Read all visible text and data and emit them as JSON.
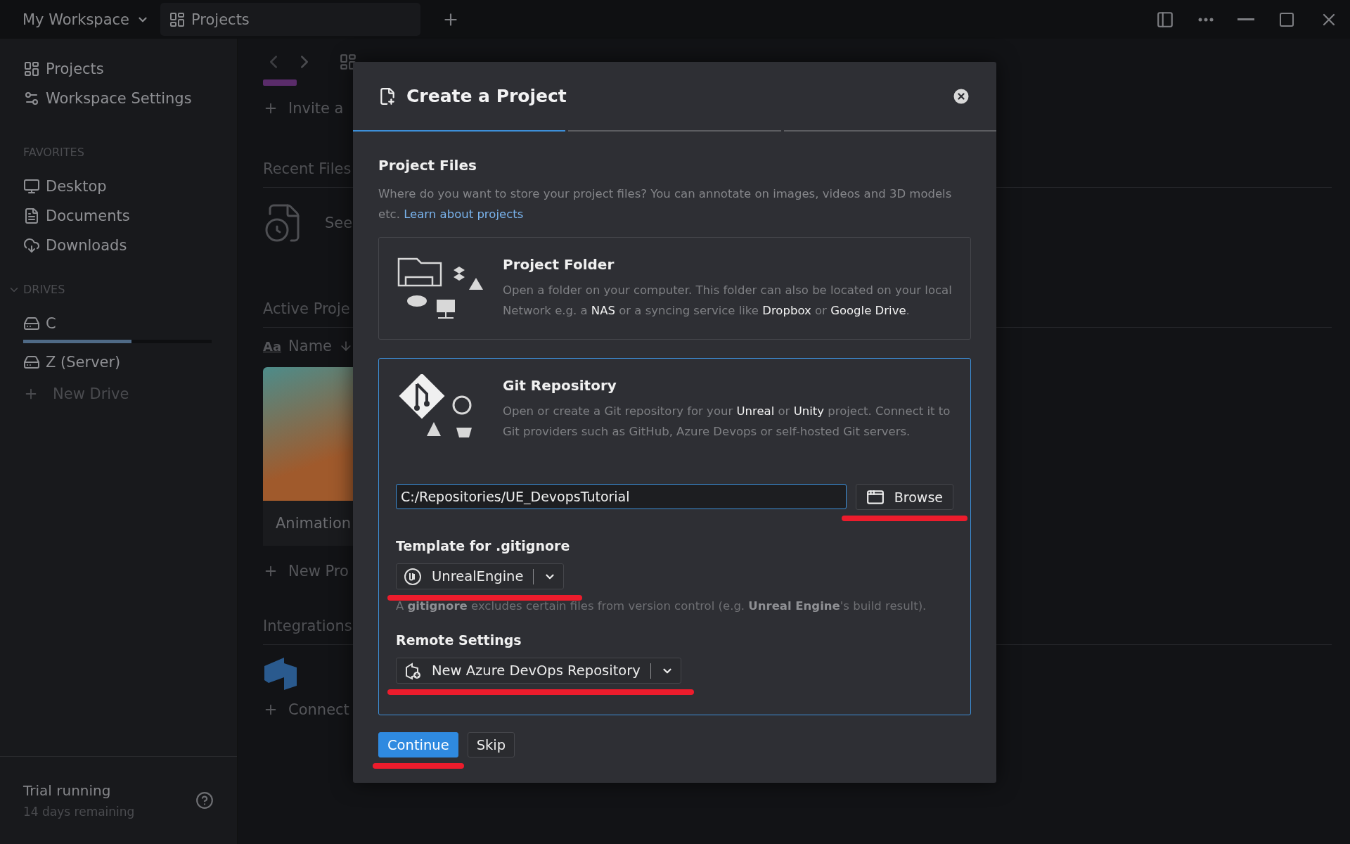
{
  "title_bar": {
    "workspace": "My Workspace",
    "tab": "Projects"
  },
  "sidebar": {
    "nav": [
      {
        "label": "Projects",
        "kind": "projects"
      },
      {
        "label": "Workspace Settings",
        "kind": "settings"
      }
    ],
    "favorites": {
      "heading": "FAVORITES",
      "items": [
        {
          "label": "Desktop",
          "kind": "desktop"
        },
        {
          "label": "Documents",
          "kind": "document"
        },
        {
          "label": "Downloads",
          "kind": "download"
        }
      ]
    },
    "drives": {
      "heading": "DRIVES",
      "expanded": true,
      "items": [
        {
          "label": "C",
          "level": 0.575
        },
        {
          "label": "Z (Server)"
        }
      ],
      "add": "New Drive"
    },
    "trial": {
      "title": "Trial running",
      "subtitle": "14 days remaining"
    }
  },
  "main": {
    "invite": "Invite a",
    "recent": {
      "heading": "Recent Files",
      "hint": "See"
    },
    "active": {
      "heading": "Active Proje",
      "sort_toggle": "Aa",
      "sort": "Name",
      "cards": [
        {
          "title": "Animation"
        }
      ],
      "add": "New Pro"
    },
    "integrations": {
      "heading": "Integrations",
      "connect": "Connect"
    }
  },
  "dialog": {
    "title": "Create a Project",
    "steps": [
      {
        "selected": true
      },
      {
        "selected": false
      },
      {
        "selected": false
      }
    ],
    "section": "Project Files",
    "description": "Where do you want to store your project files? You can annotate on images, videos and 3D models etc.",
    "link": "Learn about projects",
    "options": [
      {
        "kind": "folder",
        "title": "Project Folder",
        "description": "Open a folder on your computer. This folder can also be located on your local Network e.g. a **NAS** or a syncing service like **Dropbox** or **Google Drive**.",
        "selected": false
      },
      {
        "kind": "git",
        "title": "Git Repository",
        "description": "Open or create a Git repository for your **Unreal** or **Unity** project. Connect it to Git providers such as GitHub, Azure Devops or self-hosted Git servers.",
        "selected": true
      }
    ],
    "git": {
      "path": "C:/Repositories/UE_DevopsTutorial",
      "browse": {
        "label": "Browse",
        "highlighted": true
      },
      "template": {
        "label": "Template for .gitignore",
        "value": "UnrealEngine",
        "highlighted": true,
        "hint": "A **gitignore** excludes certain files from version control (e.g. **Unreal Engine**'s build result)."
      },
      "remote": {
        "label": "Remote Settings",
        "value": "New Azure DevOps Repository",
        "highlighted": true
      }
    },
    "buttons": [
      {
        "label": "Continue",
        "kind": "primary",
        "highlighted": true
      },
      {
        "label": "Skip",
        "kind": "secondary",
        "highlighted": false
      }
    ]
  }
}
